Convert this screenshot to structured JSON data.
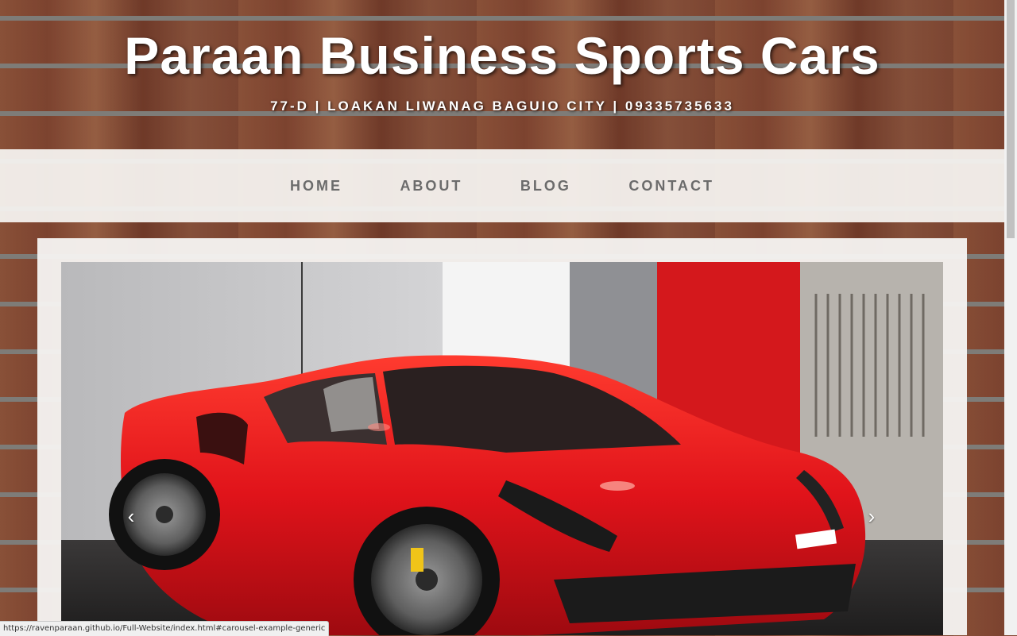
{
  "header": {
    "title": "Paraan Business Sports Cars",
    "address": "77-D | LOAKAN LIWANAG BAGUIO CITY | 09335735633"
  },
  "nav": {
    "items": [
      {
        "label": "HOME"
      },
      {
        "label": "ABOUT"
      },
      {
        "label": "BLOG"
      },
      {
        "label": "CONTACT"
      }
    ]
  },
  "carousel": {
    "prev_glyph": "‹",
    "next_glyph": "›",
    "slide_icon": "red-sports-car-image"
  },
  "status_bar": {
    "url": "https://ravenparaan.github.io/Full-Website/index.html#carousel-example-generic"
  },
  "colors": {
    "title_text": "#ffffff",
    "nav_text": "#6b6b6b",
    "car_red": "#e0131a",
    "nav_background": "#f5f3f0"
  }
}
